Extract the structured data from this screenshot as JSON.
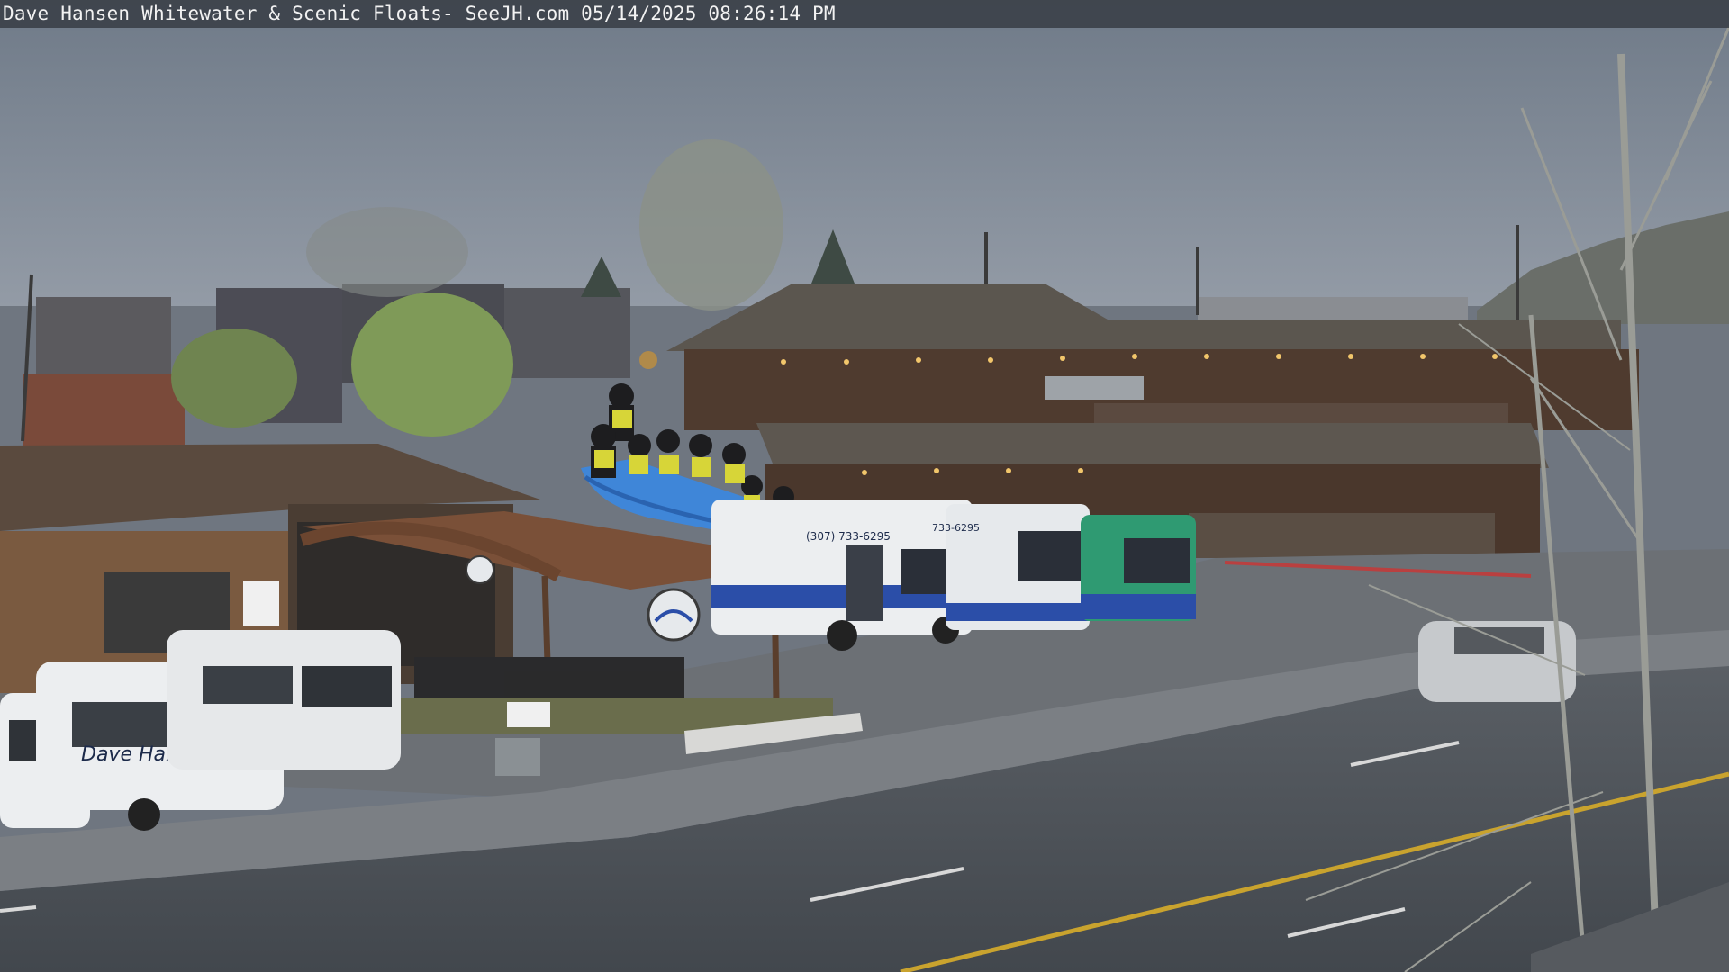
{
  "overlay": {
    "caption": "Dave Hansen Whitewater & Scenic Floats- SeeJH.com 05/14/2025 08:26:14 PM"
  },
  "signage": {
    "van_text": "Dave Hansen",
    "bus_phone_1": "(307) 733-6295",
    "bus_phone_2": "733-6295"
  },
  "colors": {
    "sky": "#7d8794",
    "roof_brown": "#5a4a3e",
    "lodge_wood": "#4e3a2e",
    "raft_blue": "#3f86d8",
    "vest_yellow": "#d7d538",
    "van_white": "#eceef0",
    "bus_blue": "#2b4ea8",
    "bus_green": "#2f9a72",
    "road": "#4d5258",
    "center_line": "#c9a32e"
  }
}
